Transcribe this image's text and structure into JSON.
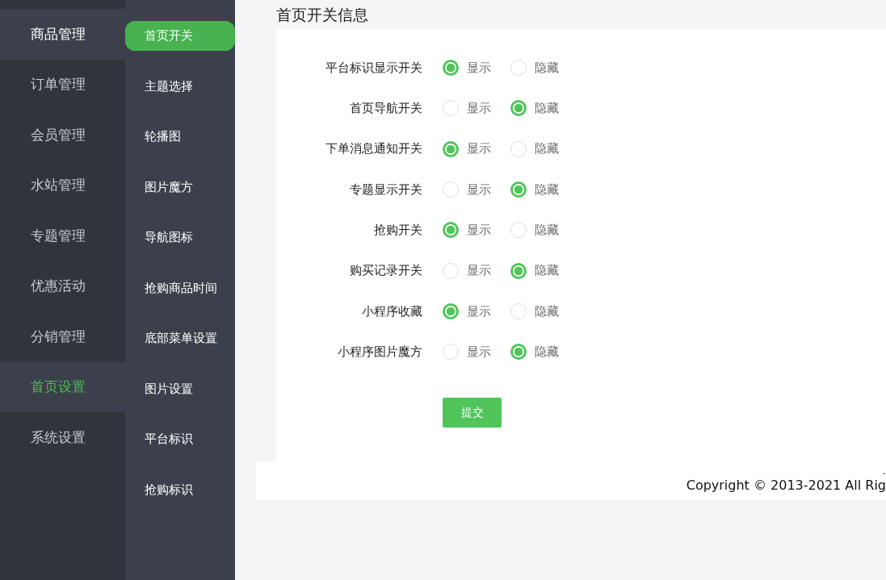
{
  "main_menu": [
    {
      "label": "商品管理",
      "selected": false,
      "highlighted": true
    },
    {
      "label": "订单管理",
      "selected": false,
      "highlighted": false
    },
    {
      "label": "会员管理",
      "selected": false,
      "highlighted": false
    },
    {
      "label": "水站管理",
      "selected": false,
      "highlighted": false
    },
    {
      "label": "专题管理",
      "selected": false,
      "highlighted": false
    },
    {
      "label": "优惠活动",
      "selected": false,
      "highlighted": false
    },
    {
      "label": "分销管理",
      "selected": false,
      "highlighted": false
    },
    {
      "label": "首页设置",
      "selected": true,
      "highlighted": true
    },
    {
      "label": "系统设置",
      "selected": false,
      "highlighted": false
    }
  ],
  "sub_menu": [
    {
      "label": "首页开关",
      "selected": true
    },
    {
      "label": "主题选择",
      "selected": false
    },
    {
      "label": "轮播图",
      "selected": false
    },
    {
      "label": "图片魔方",
      "selected": false
    },
    {
      "label": "导航图标",
      "selected": false
    },
    {
      "label": "抢购商品时间",
      "selected": false
    },
    {
      "label": "底部菜单设置",
      "selected": false
    },
    {
      "label": "图片设置",
      "selected": false
    },
    {
      "label": "平台标识",
      "selected": false
    },
    {
      "label": "抢购标识",
      "selected": false
    }
  ],
  "page_title": "首页开关信息",
  "form": {
    "rows": [
      {
        "label": "平台标识显示开关",
        "options": [
          {
            "label": "显示",
            "selected": true
          },
          {
            "label": "隐藏",
            "selected": false
          }
        ]
      },
      {
        "label": "首页导航开关",
        "options": [
          {
            "label": "显示",
            "selected": false
          },
          {
            "label": "隐藏",
            "selected": true
          }
        ]
      },
      {
        "label": "下单消息通知开关",
        "options": [
          {
            "label": "显示",
            "selected": true
          },
          {
            "label": "隐藏",
            "selected": false
          }
        ]
      },
      {
        "label": "专题显示开关",
        "options": [
          {
            "label": "显示",
            "selected": false
          },
          {
            "label": "隐藏",
            "selected": true
          }
        ]
      },
      {
        "label": "抢购开关",
        "options": [
          {
            "label": "显示",
            "selected": true
          },
          {
            "label": "隐藏",
            "selected": false
          }
        ]
      },
      {
        "label": "购买记录开关",
        "options": [
          {
            "label": "显示",
            "selected": false
          },
          {
            "label": "隐藏",
            "selected": true
          }
        ]
      },
      {
        "label": "小程序收藏",
        "options": [
          {
            "label": "显示",
            "selected": true
          },
          {
            "label": "隐藏",
            "selected": false
          }
        ]
      },
      {
        "label": "小程序图片魔方",
        "options": [
          {
            "label": "显示",
            "selected": false
          },
          {
            "label": "隐藏",
            "selected": true
          }
        ]
      }
    ],
    "submit": "提交"
  },
  "footer": {
    "mark": ".",
    "copyright": "Copyright © 2013-2021 All Rig"
  }
}
